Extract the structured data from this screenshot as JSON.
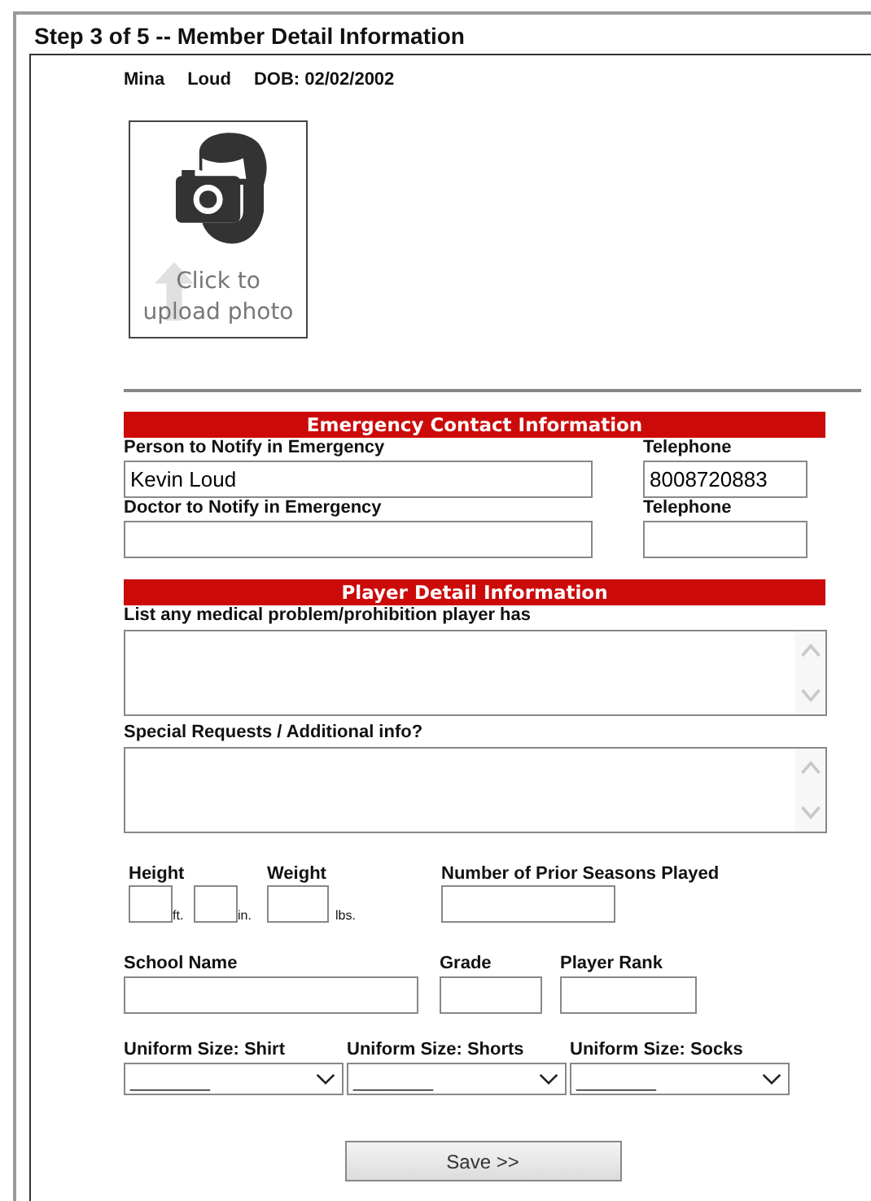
{
  "title": "Step 3 of 5 -- Member Detail Information",
  "member": {
    "first_name": "Mina",
    "last_name": "Loud",
    "dob": "DOB: 02/02/2002"
  },
  "photo": {
    "caption": [
      "Click to",
      "upload photo"
    ]
  },
  "emergency": {
    "heading": "Emergency Contact Information",
    "rows": [
      {
        "name_label": "Person to Notify in Emergency",
        "name_value": "Kevin Loud",
        "phone_label": "Telephone",
        "phone_value": "8008720883"
      },
      {
        "name_label": "Doctor to Notify in Emergency",
        "phone_label": "Telephone"
      }
    ]
  },
  "player": {
    "heading": "Player Detail Information",
    "textareas": [
      {
        "label": "List any medical problem/prohibition player has"
      },
      {
        "label": "Special Requests / Additional info?"
      }
    ],
    "height_label": "Height",
    "weight_label": "Weight",
    "ft_unit": "ft.",
    "in_unit": "in.",
    "lbs_unit": "lbs.",
    "seasons_label": "Number of Prior Seasons Played",
    "school_label": "School Name",
    "grade_label": "Grade",
    "rank_label": "Player Rank",
    "uniform": [
      {
        "label": "Uniform Size: Shirt",
        "value": "________"
      },
      {
        "label": "Uniform Size: Shorts",
        "value": "________"
      },
      {
        "label": "Uniform Size: Socks",
        "value": "________"
      }
    ]
  },
  "save_button": "Save >>"
}
